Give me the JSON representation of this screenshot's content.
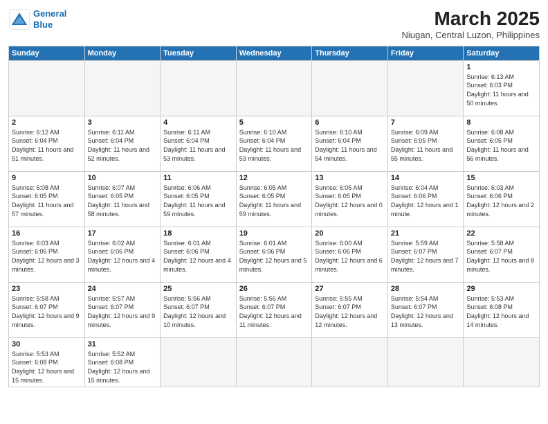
{
  "logo": {
    "line1": "General",
    "line2": "Blue"
  },
  "title": "March 2025",
  "subtitle": "Niugan, Central Luzon, Philippines",
  "weekdays": [
    "Sunday",
    "Monday",
    "Tuesday",
    "Wednesday",
    "Thursday",
    "Friday",
    "Saturday"
  ],
  "weeks": [
    [
      {
        "day": "",
        "info": ""
      },
      {
        "day": "",
        "info": ""
      },
      {
        "day": "",
        "info": ""
      },
      {
        "day": "",
        "info": ""
      },
      {
        "day": "",
        "info": ""
      },
      {
        "day": "",
        "info": ""
      },
      {
        "day": "1",
        "info": "Sunrise: 6:13 AM\nSunset: 6:03 PM\nDaylight: 11 hours\nand 50 minutes."
      }
    ],
    [
      {
        "day": "2",
        "info": "Sunrise: 6:12 AM\nSunset: 6:04 PM\nDaylight: 11 hours\nand 51 minutes."
      },
      {
        "day": "3",
        "info": "Sunrise: 6:11 AM\nSunset: 6:04 PM\nDaylight: 11 hours\nand 52 minutes."
      },
      {
        "day": "4",
        "info": "Sunrise: 6:11 AM\nSunset: 6:04 PM\nDaylight: 11 hours\nand 53 minutes."
      },
      {
        "day": "5",
        "info": "Sunrise: 6:10 AM\nSunset: 6:04 PM\nDaylight: 11 hours\nand 53 minutes."
      },
      {
        "day": "6",
        "info": "Sunrise: 6:10 AM\nSunset: 6:04 PM\nDaylight: 11 hours\nand 54 minutes."
      },
      {
        "day": "7",
        "info": "Sunrise: 6:09 AM\nSunset: 6:05 PM\nDaylight: 11 hours\nand 55 minutes."
      },
      {
        "day": "8",
        "info": "Sunrise: 6:08 AM\nSunset: 6:05 PM\nDaylight: 11 hours\nand 56 minutes."
      }
    ],
    [
      {
        "day": "9",
        "info": "Sunrise: 6:08 AM\nSunset: 6:05 PM\nDaylight: 11 hours\nand 57 minutes."
      },
      {
        "day": "10",
        "info": "Sunrise: 6:07 AM\nSunset: 6:05 PM\nDaylight: 11 hours\nand 58 minutes."
      },
      {
        "day": "11",
        "info": "Sunrise: 6:06 AM\nSunset: 6:05 PM\nDaylight: 11 hours\nand 59 minutes."
      },
      {
        "day": "12",
        "info": "Sunrise: 6:05 AM\nSunset: 6:05 PM\nDaylight: 11 hours\nand 59 minutes."
      },
      {
        "day": "13",
        "info": "Sunrise: 6:05 AM\nSunset: 6:05 PM\nDaylight: 12 hours\nand 0 minutes."
      },
      {
        "day": "14",
        "info": "Sunrise: 6:04 AM\nSunset: 6:06 PM\nDaylight: 12 hours\nand 1 minute."
      },
      {
        "day": "15",
        "info": "Sunrise: 6:03 AM\nSunset: 6:06 PM\nDaylight: 12 hours\nand 2 minutes."
      }
    ],
    [
      {
        "day": "16",
        "info": "Sunrise: 6:03 AM\nSunset: 6:06 PM\nDaylight: 12 hours\nand 3 minutes."
      },
      {
        "day": "17",
        "info": "Sunrise: 6:02 AM\nSunset: 6:06 PM\nDaylight: 12 hours\nand 4 minutes."
      },
      {
        "day": "18",
        "info": "Sunrise: 6:01 AM\nSunset: 6:06 PM\nDaylight: 12 hours\nand 4 minutes."
      },
      {
        "day": "19",
        "info": "Sunrise: 6:01 AM\nSunset: 6:06 PM\nDaylight: 12 hours\nand 5 minutes."
      },
      {
        "day": "20",
        "info": "Sunrise: 6:00 AM\nSunset: 6:06 PM\nDaylight: 12 hours\nand 6 minutes."
      },
      {
        "day": "21",
        "info": "Sunrise: 5:59 AM\nSunset: 6:07 PM\nDaylight: 12 hours\nand 7 minutes."
      },
      {
        "day": "22",
        "info": "Sunrise: 5:58 AM\nSunset: 6:07 PM\nDaylight: 12 hours\nand 8 minutes."
      }
    ],
    [
      {
        "day": "23",
        "info": "Sunrise: 5:58 AM\nSunset: 6:07 PM\nDaylight: 12 hours\nand 9 minutes."
      },
      {
        "day": "24",
        "info": "Sunrise: 5:57 AM\nSunset: 6:07 PM\nDaylight: 12 hours\nand 9 minutes."
      },
      {
        "day": "25",
        "info": "Sunrise: 5:56 AM\nSunset: 6:07 PM\nDaylight: 12 hours\nand 10 minutes."
      },
      {
        "day": "26",
        "info": "Sunrise: 5:56 AM\nSunset: 6:07 PM\nDaylight: 12 hours\nand 11 minutes."
      },
      {
        "day": "27",
        "info": "Sunrise: 5:55 AM\nSunset: 6:07 PM\nDaylight: 12 hours\nand 12 minutes."
      },
      {
        "day": "28",
        "info": "Sunrise: 5:54 AM\nSunset: 6:07 PM\nDaylight: 12 hours\nand 13 minutes."
      },
      {
        "day": "29",
        "info": "Sunrise: 5:53 AM\nSunset: 6:08 PM\nDaylight: 12 hours\nand 14 minutes."
      }
    ],
    [
      {
        "day": "30",
        "info": "Sunrise: 5:53 AM\nSunset: 6:08 PM\nDaylight: 12 hours\nand 15 minutes."
      },
      {
        "day": "31",
        "info": "Sunrise: 5:52 AM\nSunset: 6:08 PM\nDaylight: 12 hours\nand 15 minutes."
      },
      {
        "day": "",
        "info": ""
      },
      {
        "day": "",
        "info": ""
      },
      {
        "day": "",
        "info": ""
      },
      {
        "day": "",
        "info": ""
      },
      {
        "day": "",
        "info": ""
      }
    ]
  ]
}
